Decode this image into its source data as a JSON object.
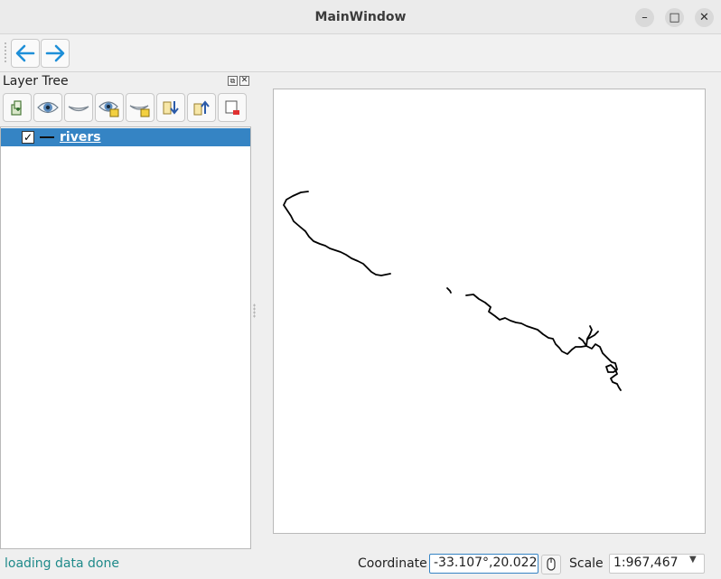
{
  "window": {
    "title": "MainWindow",
    "controls": {
      "minimize": "–",
      "maximize": "□",
      "close": "✕"
    }
  },
  "toolbar": {
    "items": [
      {
        "name": "back",
        "icon": "arrow-left-icon"
      },
      {
        "name": "forward",
        "icon": "arrow-right-icon"
      }
    ],
    "accent_color": "#1e8fd8"
  },
  "layer_tree": {
    "title": "Layer Tree",
    "float_glyph": "⧉",
    "close_glyph": "✕",
    "toolbar_icons": [
      "add-group-icon",
      "show-all-icon",
      "hide-all-icon",
      "show-selected-icon",
      "hide-selected-icon",
      "expand-all-icon",
      "collapse-all-icon",
      "remove-layer-icon"
    ],
    "layers": [
      {
        "name": "rivers",
        "checked": true,
        "check_glyph": "✓",
        "selected": true
      }
    ],
    "selection_color": "#3584c4"
  },
  "map": {
    "background": "#ffffff",
    "feature_color": "#000000"
  },
  "statusbar": {
    "message": "loading data done",
    "coordinate_label": "Coordinate",
    "coordinate_value": "-33.107°,20.022°",
    "scale_label": "Scale",
    "scale_value": "1:967,467"
  }
}
